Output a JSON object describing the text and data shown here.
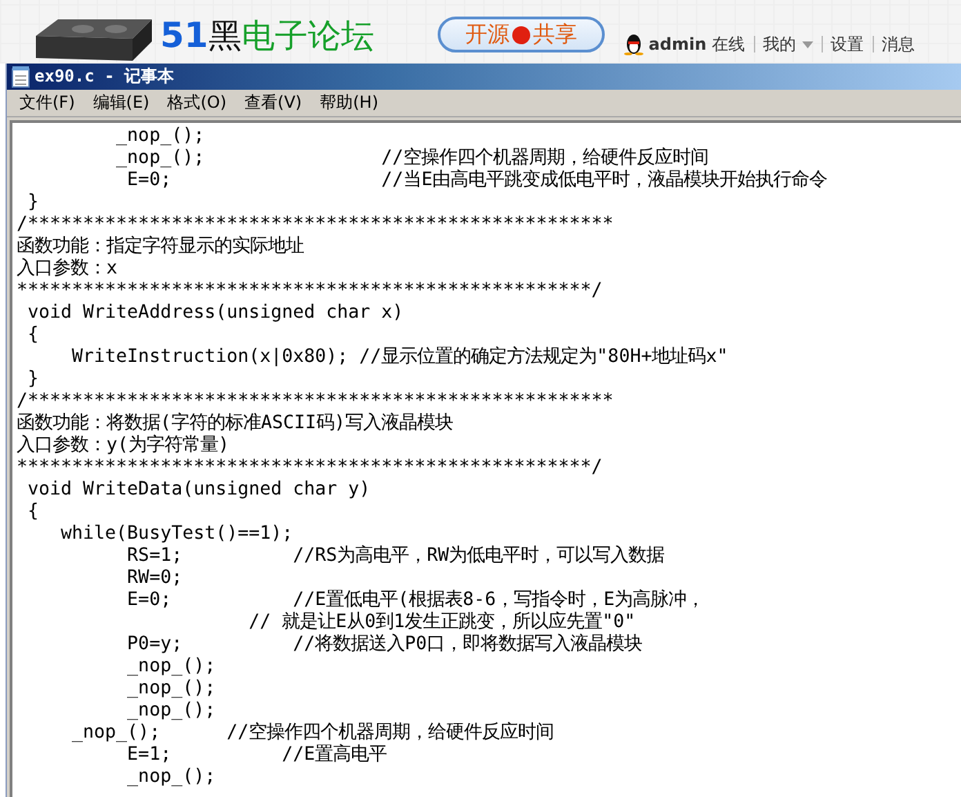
{
  "banner": {
    "logo_parts": [
      {
        "text": "51",
        "color": "#1560d8"
      },
      {
        "text": "黑",
        "color": "#111111"
      },
      {
        "text": "电子论坛",
        "color": "#16a02a"
      }
    ],
    "slogan": {
      "left": "开源",
      "right": "共享"
    },
    "user": {
      "name": "admin",
      "status": "在线"
    },
    "links": [
      {
        "label": "我的",
        "dropdown": true
      },
      {
        "label": "设置",
        "dropdown": false
      },
      {
        "label": "消息",
        "dropdown": false
      }
    ]
  },
  "window": {
    "title": "ex90.c - 记事本"
  },
  "menu": [
    "文件(F)",
    "编辑(E)",
    "格式(O)",
    "查看(V)",
    "帮助(H)"
  ],
  "lines": [
    "         _nop_();",
    "         _nop_();                //空操作四个机器周期，给硬件反应时间",
    "          E=0;                   //当E由高电平跳变成低电平时，液晶模块开始执行命令",
    " }",
    "/*****************************************************",
    "函数功能：指定字符显示的实际地址",
    "入口参数：x",
    "****************************************************/",
    " void WriteAddress(unsigned char x)",
    " {",
    "     WriteInstruction(x|0x80); //显示位置的确定方法规定为\"80H+地址码x\"",
    " }",
    "/*****************************************************",
    "函数功能：将数据(字符的标准ASCII码)写入液晶模块",
    "入口参数：y(为字符常量)",
    "****************************************************/",
    " void WriteData(unsigned char y)",
    " {",
    "    while(BusyTest()==1);",
    "          RS=1;          //RS为高电平，RW为低电平时，可以写入数据",
    "          RW=0;",
    "          E=0;           //E置低电平(根据表8-6，写指令时，E为高脉冲，",
    "                     // 就是让E从0到1发生正跳变，所以应先置\"0\"",
    "          P0=y;          //将数据送入P0口，即将数据写入液晶模块",
    "          _nop_();",
    "          _nop_();",
    "          _nop_();",
    "     _nop_();      //空操作四个机器周期，给硬件反应时间",
    "          E=1;          //E置高电平",
    "          _nop_();"
  ]
}
